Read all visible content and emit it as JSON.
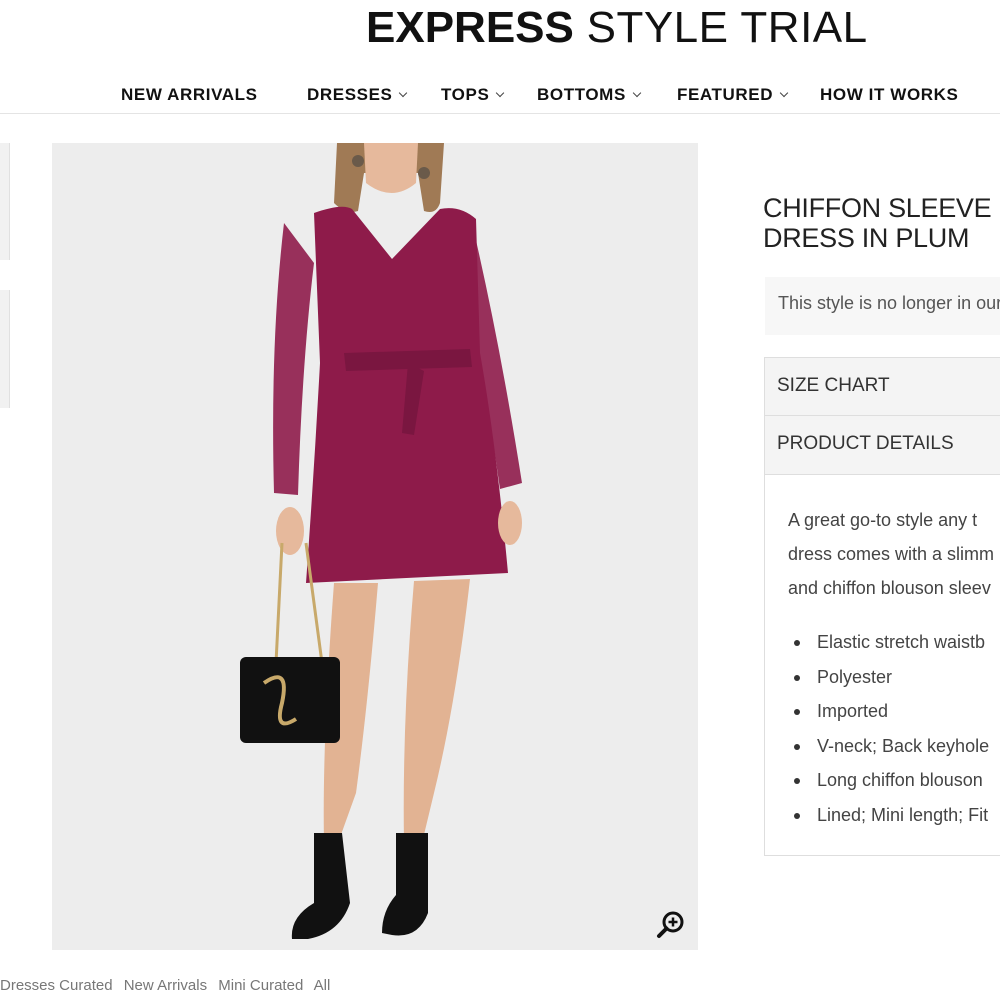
{
  "header": {
    "brand_bold": "EXPRESS",
    "brand_light": "STYLE TRIAL"
  },
  "nav": {
    "items": [
      {
        "label": "NEW ARRIVALS",
        "has_dropdown": false
      },
      {
        "label": "DRESSES",
        "has_dropdown": true
      },
      {
        "label": "TOPS",
        "has_dropdown": true
      },
      {
        "label": "BOTTOMS",
        "has_dropdown": true
      },
      {
        "label": "FEATURED",
        "has_dropdown": true
      },
      {
        "label": "HOW IT WORKS",
        "has_dropdown": false
      }
    ]
  },
  "product": {
    "title_line1": "CHIFFON SLEEVE",
    "title_line2": "DRESS IN PLUM",
    "notice": "This style is no longer in our",
    "dress_color": "#8e1b4a",
    "accordion": {
      "size_chart": "SIZE CHART",
      "product_details": "PRODUCT DETAILS"
    },
    "description": [
      "A great go-to style any t",
      "dress comes with a slimm",
      "and chiffon blouson sleev"
    ],
    "details": [
      "Elastic stretch waistb",
      "Polyester",
      "Imported",
      "V-neck; Back keyhole",
      "Long chiffon blouson",
      "Lined; Mini length; Fit"
    ]
  },
  "image": {
    "zoom_icon": "zoom-in-icon"
  },
  "breadcrumbs": [
    "Dresses Curated",
    "New Arrivals",
    "Mini Curated",
    "All"
  ]
}
